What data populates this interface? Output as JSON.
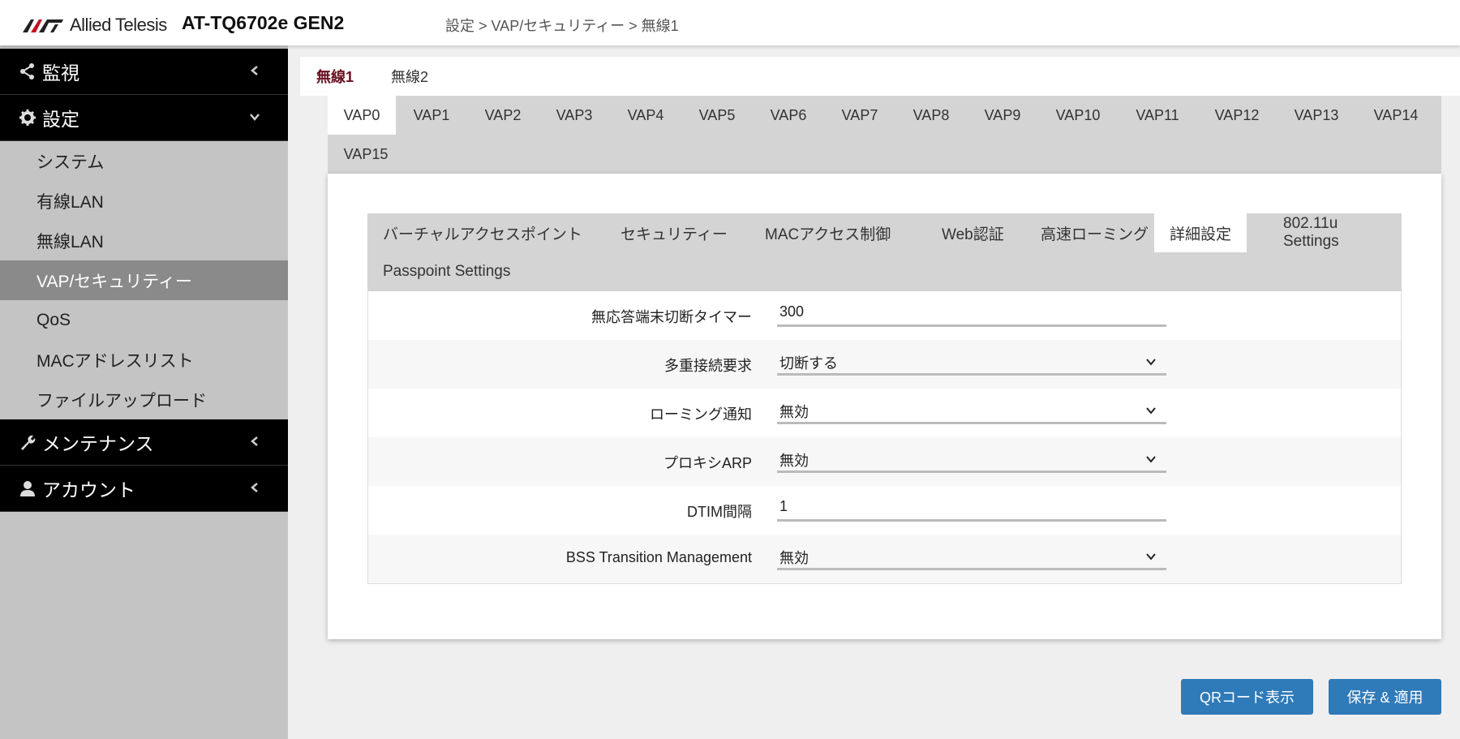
{
  "header": {
    "logo_text": "Allied Telesis",
    "product": "AT-TQ6702e GEN2",
    "breadcrumb": "設定 > VAP/セキュリティー > 無線1"
  },
  "sidebar": {
    "sections": [
      {
        "label": "監視",
        "icon": "share-icon",
        "state": "collapsed"
      },
      {
        "label": "設定",
        "icon": "gear-icon",
        "state": "expanded"
      },
      {
        "label": "メンテナンス",
        "icon": "wrench-icon",
        "state": "collapsed"
      },
      {
        "label": "アカウント",
        "icon": "user-icon",
        "state": "collapsed"
      }
    ],
    "settings_items": [
      {
        "label": "システム"
      },
      {
        "label": "有線LAN"
      },
      {
        "label": "無線LAN"
      },
      {
        "label": "VAP/セキュリティー",
        "active": true
      },
      {
        "label": "QoS"
      },
      {
        "label": "MACアドレスリスト"
      },
      {
        "label": "ファイルアップロード"
      }
    ]
  },
  "radio_tabs": [
    {
      "label": "無線1",
      "active": true
    },
    {
      "label": "無線2"
    }
  ],
  "vap_tabs": [
    "VAP0",
    "VAP1",
    "VAP2",
    "VAP3",
    "VAP4",
    "VAP5",
    "VAP6",
    "VAP7",
    "VAP8",
    "VAP9",
    "VAP10",
    "VAP11",
    "VAP12",
    "VAP13",
    "VAP14",
    "VAP15"
  ],
  "vap_active": "VAP0",
  "sub_tabs": [
    "バーチャルアクセスポイント",
    "セキュリティー",
    "MACアクセス制御",
    "Web認証",
    "高速ローミング",
    "詳細設定",
    "802.11u Settings",
    "Passpoint Settings"
  ],
  "sub_active": "詳細設定",
  "form": {
    "fields": [
      {
        "label": "無応答端末切断タイマー",
        "value": "300",
        "type": "text"
      },
      {
        "label": "多重接続要求",
        "value": "切断する",
        "type": "select"
      },
      {
        "label": "ローミング通知",
        "value": "無効",
        "type": "select"
      },
      {
        "label": "プロキシARP",
        "value": "無効",
        "type": "select"
      },
      {
        "label": "DTIM間隔",
        "value": "1",
        "type": "text"
      },
      {
        "label": "BSS Transition Management",
        "value": "無効",
        "type": "select"
      }
    ]
  },
  "buttons": {
    "qr": "QRコード表示",
    "save": "保存 & 適用"
  },
  "colors": {
    "primary_button": "#2f7ab9",
    "sidebar_section": "#000000",
    "active_radio_tab": "#6a0f1f"
  }
}
